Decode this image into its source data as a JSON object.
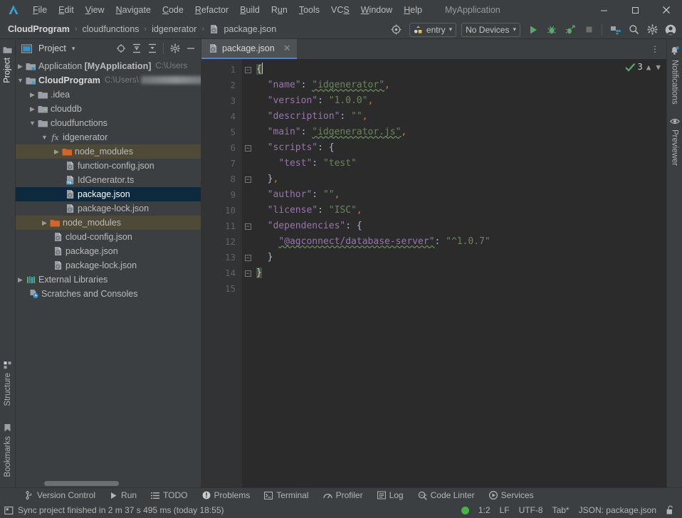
{
  "window": {
    "app_name": "MyApplication",
    "logo_icon": "devtools-logo-icon",
    "minimize": "─",
    "maximize": "□",
    "close": "✕"
  },
  "menubar": {
    "items": [
      {
        "label": "File",
        "mnemonic": "F"
      },
      {
        "label": "Edit",
        "mnemonic": "E"
      },
      {
        "label": "View",
        "mnemonic": "V"
      },
      {
        "label": "Navigate",
        "mnemonic": "N"
      },
      {
        "label": "Code",
        "mnemonic": "C"
      },
      {
        "label": "Refactor",
        "mnemonic": "R"
      },
      {
        "label": "Build",
        "mnemonic": "B"
      },
      {
        "label": "Run",
        "mnemonic": "u"
      },
      {
        "label": "Tools",
        "mnemonic": "T"
      },
      {
        "label": "VCS",
        "mnemonic": "S"
      },
      {
        "label": "Window",
        "mnemonic": "W"
      },
      {
        "label": "Help",
        "mnemonic": "H"
      }
    ]
  },
  "navbar": {
    "breadcrumbs": [
      {
        "label": "CloudProgram",
        "bold": true,
        "icon": null
      },
      {
        "label": "cloudfunctions",
        "bold": false,
        "icon": null
      },
      {
        "label": "idgenerator",
        "bold": false,
        "icon": null
      },
      {
        "label": "package.json",
        "bold": false,
        "icon": "json-file-icon"
      }
    ],
    "separator": "›",
    "target_icon": "target-device-icon",
    "run_config": {
      "label": "entry",
      "icon": "module-icon",
      "caret": "▾"
    },
    "device_selector": {
      "label": "No Devices",
      "caret": "▾"
    },
    "buttons": [
      {
        "name": "run-button",
        "icon": "play-icon",
        "color": "#59a869"
      },
      {
        "name": "debug-button",
        "icon": "bug-icon",
        "color": "#59a869"
      },
      {
        "name": "attach-debugger-button",
        "icon": "bug-attach-icon",
        "color": "#59a869"
      },
      {
        "name": "stop-button",
        "icon": "stop-icon",
        "color": "#6e6e6e"
      },
      {
        "name": "device-manager-button",
        "icon": "device-manager-icon",
        "color": "#3592c4"
      },
      {
        "name": "search-everywhere-button",
        "icon": "search-icon",
        "color": "#b4b4b4"
      },
      {
        "name": "settings-button",
        "icon": "gear-icon",
        "color": "#b4b4b4"
      },
      {
        "name": "account-button",
        "icon": "account-icon",
        "color": "#b4b4b4"
      }
    ]
  },
  "left_strip": {
    "top": [
      {
        "label": "Project",
        "icon": "project-folder-icon",
        "active": true
      }
    ],
    "bottom": [
      {
        "label": "Structure",
        "icon": "structure-icon"
      },
      {
        "label": "Bookmarks",
        "icon": "bookmark-icon"
      }
    ]
  },
  "right_strip": {
    "items": [
      {
        "label": "Notifications",
        "icon": "bell-icon",
        "badge": true
      },
      {
        "label": "Previewer",
        "icon": "eye-icon",
        "badge": false
      }
    ]
  },
  "project_panel": {
    "title": "Project",
    "title_caret": "▾",
    "header_icons": [
      {
        "name": "select-opened-file-icon",
        "glyph": "⊕"
      },
      {
        "name": "expand-all-icon",
        "glyph": "expand"
      },
      {
        "name": "collapse-all-icon",
        "glyph": "collapse"
      },
      {
        "name": "panel-settings-icon",
        "glyph": "gear"
      },
      {
        "name": "hide-panel-icon",
        "glyph": "─"
      }
    ],
    "tree": [
      {
        "indent": 0,
        "arrow": "right",
        "icon": "module-icon",
        "label": "Application [MyApplication]",
        "bold_part": "[MyApplication]",
        "path": "C:\\Users",
        "blurred": false,
        "state": "normal"
      },
      {
        "indent": 0,
        "arrow": "down",
        "icon": "module-cloud-icon",
        "label": "CloudProgram",
        "bold": true,
        "path": "C:\\Users\\",
        "blurred": true,
        "state": "normal"
      },
      {
        "indent": 1,
        "arrow": "right",
        "icon": "folder-icon",
        "label": ".idea",
        "state": "normal"
      },
      {
        "indent": 1,
        "arrow": "right",
        "icon": "folder-db-icon",
        "label": "clouddb",
        "state": "normal"
      },
      {
        "indent": 1,
        "arrow": "down",
        "icon": "folder-fn-icon",
        "label": "cloudfunctions",
        "state": "normal"
      },
      {
        "indent": 2,
        "arrow": "down",
        "icon": "fx-icon",
        "label": "idgenerator",
        "state": "normal"
      },
      {
        "indent": 3,
        "arrow": "right",
        "icon": "folder-orange-icon",
        "label": "node_modules",
        "state": "excluded"
      },
      {
        "indent": 4,
        "arrow": "none",
        "icon": "json-file-icon",
        "label": "function-config.json",
        "state": "normal"
      },
      {
        "indent": 4,
        "arrow": "none",
        "icon": "ts-file-icon",
        "label": "IdGenerator.ts",
        "state": "normal"
      },
      {
        "indent": 4,
        "arrow": "none",
        "icon": "json-file-icon",
        "label": "package.json",
        "state": "selected"
      },
      {
        "indent": 4,
        "arrow": "none",
        "icon": "json-file-icon",
        "label": "package-lock.json",
        "state": "normal"
      },
      {
        "indent": 2,
        "arrow": "right",
        "icon": "folder-orange-icon",
        "label": "node_modules",
        "state": "excluded"
      },
      {
        "indent": 3,
        "arrow": "none",
        "icon": "json-file-icon",
        "label": "cloud-config.json",
        "state": "normal"
      },
      {
        "indent": 3,
        "arrow": "none",
        "icon": "json-file-icon",
        "label": "package.json",
        "state": "normal"
      },
      {
        "indent": 3,
        "arrow": "none",
        "icon": "json-file-icon",
        "label": "package-lock.json",
        "state": "normal"
      },
      {
        "indent": 0,
        "arrow": "right",
        "icon": "libraries-icon",
        "label": "External Libraries",
        "state": "normal"
      },
      {
        "indent": 0,
        "arrow": "none",
        "icon": "scratches-icon",
        "label": "Scratches and Consoles",
        "state": "normal"
      }
    ]
  },
  "editor": {
    "tabs": [
      {
        "label": "package.json",
        "icon": "json-file-icon",
        "active": true,
        "close": "✕"
      }
    ],
    "kebab": "⋮",
    "inspection": {
      "count": "3",
      "icon": "checkmark-icon",
      "up": "⌃",
      "down": "⌄"
    },
    "lines": [
      {
        "num": "1",
        "fold": "minus-top",
        "text": "{",
        "tokens": [
          {
            "t": "{",
            "c": "brace-hl"
          }
        ]
      },
      {
        "num": "2",
        "fold": "none",
        "bulb": true,
        "tokens": [
          {
            "t": "  ",
            "c": "p"
          },
          {
            "t": "\"name\"",
            "c": "k"
          },
          {
            "t": ": ",
            "c": "p"
          },
          {
            "t": "\"idgenerator\"",
            "c": "s squig"
          },
          {
            "t": ",",
            "c": "c"
          }
        ]
      },
      {
        "num": "3",
        "fold": "none",
        "tokens": [
          {
            "t": "  ",
            "c": "p"
          },
          {
            "t": "\"version\"",
            "c": "k"
          },
          {
            "t": ": ",
            "c": "p"
          },
          {
            "t": "\"1.0.0\"",
            "c": "s"
          },
          {
            "t": ",",
            "c": "c"
          }
        ]
      },
      {
        "num": "4",
        "fold": "none",
        "tokens": [
          {
            "t": "  ",
            "c": "p"
          },
          {
            "t": "\"description\"",
            "c": "k"
          },
          {
            "t": ": ",
            "c": "p"
          },
          {
            "t": "\"\"",
            "c": "s"
          },
          {
            "t": ",",
            "c": "c"
          }
        ]
      },
      {
        "num": "5",
        "fold": "none",
        "tokens": [
          {
            "t": "  ",
            "c": "p"
          },
          {
            "t": "\"main\"",
            "c": "k"
          },
          {
            "t": ": ",
            "c": "p"
          },
          {
            "t": "\"idgenerator.js\"",
            "c": "s squig"
          },
          {
            "t": ",",
            "c": "c"
          }
        ]
      },
      {
        "num": "6",
        "fold": "minus-top",
        "tokens": [
          {
            "t": "  ",
            "c": "p"
          },
          {
            "t": "\"scripts\"",
            "c": "k"
          },
          {
            "t": ": ",
            "c": "p"
          },
          {
            "t": "{",
            "c": "p"
          }
        ]
      },
      {
        "num": "7",
        "fold": "none",
        "tokens": [
          {
            "t": "    ",
            "c": "p"
          },
          {
            "t": "\"test\"",
            "c": "k"
          },
          {
            "t": ": ",
            "c": "p"
          },
          {
            "t": "\"test\"",
            "c": "s"
          }
        ]
      },
      {
        "num": "8",
        "fold": "minus-bot",
        "tokens": [
          {
            "t": "  ",
            "c": "p"
          },
          {
            "t": "}",
            "c": "p"
          },
          {
            "t": ",",
            "c": "c"
          }
        ]
      },
      {
        "num": "9",
        "fold": "none",
        "tokens": [
          {
            "t": "  ",
            "c": "p"
          },
          {
            "t": "\"author\"",
            "c": "k"
          },
          {
            "t": ": ",
            "c": "p"
          },
          {
            "t": "\"\"",
            "c": "s"
          },
          {
            "t": ",",
            "c": "c"
          }
        ]
      },
      {
        "num": "10",
        "fold": "none",
        "tokens": [
          {
            "t": "  ",
            "c": "p"
          },
          {
            "t": "\"license\"",
            "c": "k"
          },
          {
            "t": ": ",
            "c": "p"
          },
          {
            "t": "\"ISC\"",
            "c": "s"
          },
          {
            "t": ",",
            "c": "c"
          }
        ]
      },
      {
        "num": "11",
        "fold": "minus-top",
        "tokens": [
          {
            "t": "  ",
            "c": "p"
          },
          {
            "t": "\"dependencies\"",
            "c": "k"
          },
          {
            "t": ": ",
            "c": "p"
          },
          {
            "t": "{",
            "c": "p"
          }
        ]
      },
      {
        "num": "12",
        "fold": "none",
        "tokens": [
          {
            "t": "    ",
            "c": "p"
          },
          {
            "t": "\"@agconnect/database-server\"",
            "c": "k squig"
          },
          {
            "t": ": ",
            "c": "p"
          },
          {
            "t": "\"^1.0.7\"",
            "c": "s"
          }
        ]
      },
      {
        "num": "13",
        "fold": "minus-bot",
        "tokens": [
          {
            "t": "  ",
            "c": "p"
          },
          {
            "t": "}",
            "c": "p"
          }
        ]
      },
      {
        "num": "14",
        "fold": "minus-bot",
        "tokens": [
          {
            "t": "}",
            "c": "brace-hl"
          }
        ]
      },
      {
        "num": "15",
        "fold": "none",
        "tokens": []
      }
    ]
  },
  "toolwindow_bar": {
    "items": [
      {
        "label": "Version Control",
        "icon": "branch-icon"
      },
      {
        "label": "Run",
        "icon": "play-icon"
      },
      {
        "label": "TODO",
        "icon": "list-icon"
      },
      {
        "label": "Problems",
        "icon": "problems-icon"
      },
      {
        "label": "Terminal",
        "icon": "terminal-icon"
      },
      {
        "label": "Profiler",
        "icon": "profiler-icon"
      },
      {
        "label": "Log",
        "icon": "log-icon"
      },
      {
        "label": "Code Linter",
        "icon": "linter-icon"
      },
      {
        "label": "Services",
        "icon": "services-icon"
      }
    ]
  },
  "statusbar": {
    "message_icon": "event-log-icon",
    "message": "Sync project finished in 2 m 37 s 495 ms (today 18:55)",
    "indicator_color": "#49b349",
    "caret_position": "1:2",
    "line_separator": "LF",
    "encoding": "UTF-8",
    "indent": "Tab*",
    "file_type": "JSON: package.json",
    "lock_icon": "unlocked-icon"
  },
  "colors": {
    "accent": "#4a88c7",
    "selection": "#0d293e",
    "excluded": "#4e4a37",
    "panel_bg": "#3c3f41",
    "editor_bg": "#2b2b2b",
    "gutter_bg": "#313335",
    "green": "#59a869",
    "orange": "#cc7832",
    "key_purple": "#9876aa",
    "string_green": "#6a8759"
  }
}
